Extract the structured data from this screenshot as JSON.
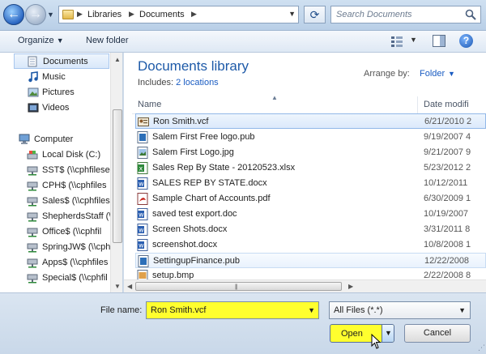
{
  "navigation": {
    "back_glyph": "←",
    "forward_glyph": "→",
    "address": {
      "crumbs": [
        "Libraries",
        "Documents"
      ]
    },
    "search": {
      "placeholder": "Search Documents"
    },
    "refresh_icon": "refresh-icon"
  },
  "toolbar": {
    "organize_label": "Organize",
    "new_folder_label": "New folder",
    "icons": [
      "views-icon",
      "preview-pane-icon",
      "help-icon"
    ]
  },
  "sidebar": {
    "items": [
      {
        "label": "Documents",
        "icon": "documents-icon",
        "selected": true
      },
      {
        "label": "Music",
        "icon": "music-icon"
      },
      {
        "label": "Pictures",
        "icon": "pictures-icon"
      },
      {
        "label": "Videos",
        "icon": "videos-icon"
      },
      {
        "label": "Computer",
        "icon": "computer-icon"
      },
      {
        "label": "Local Disk (C:)",
        "icon": "disk-icon"
      },
      {
        "label": "SST$ (\\\\cphfilese",
        "icon": "network-drive-icon"
      },
      {
        "label": "CPH$ (\\\\cphfiles",
        "icon": "network-drive-icon"
      },
      {
        "label": "Sales$ (\\\\cphfiles",
        "icon": "network-drive-icon"
      },
      {
        "label": "ShepherdsStaff (\\",
        "icon": "network-drive-icon"
      },
      {
        "label": "Office$ (\\\\cphfil",
        "icon": "network-drive-icon"
      },
      {
        "label": "SpringJW$ (\\\\cph",
        "icon": "network-drive-icon"
      },
      {
        "label": "Apps$ (\\\\cphfiles",
        "icon": "network-drive-icon"
      },
      {
        "label": "Special$ (\\\\cphfil",
        "icon": "network-drive-icon"
      }
    ]
  },
  "main": {
    "library_title": "Documents library",
    "includes_label": "Includes:",
    "includes_link": "2 locations",
    "arrange_label": "Arrange by:",
    "arrange_value": "Folder",
    "columns": {
      "name": "Name",
      "date": "Date modifi"
    },
    "files": [
      {
        "name": "Ron Smith.vcf",
        "date": "6/21/2010 2",
        "icon": "vcard-icon",
        "selected": true
      },
      {
        "name": "Salem First Free logo.pub",
        "date": "9/19/2007 4",
        "icon": "publisher-icon"
      },
      {
        "name": "Salem First Logo.jpg",
        "date": "9/21/2007 9",
        "icon": "image-icon"
      },
      {
        "name": "Sales Rep By State - 20120523.xlsx",
        "date": "5/23/2012 2",
        "icon": "excel-icon"
      },
      {
        "name": "SALES REP BY STATE.docx",
        "date": "10/12/2011",
        "icon": "word-icon"
      },
      {
        "name": "Sample Chart of Accounts.pdf",
        "date": "6/30/2009 1",
        "icon": "pdf-icon"
      },
      {
        "name": "saved test export.doc",
        "date": "10/19/2007",
        "icon": "word-icon"
      },
      {
        "name": "Screen Shots.docx",
        "date": "3/31/2011 8",
        "icon": "word-icon"
      },
      {
        "name": "screenshot.docx",
        "date": "10/8/2008 1",
        "icon": "word-icon"
      },
      {
        "name": "SettingupFinance.pub",
        "date": "12/22/2008",
        "icon": "publisher-icon",
        "hover": true
      },
      {
        "name": "setup.bmp",
        "date": "2/22/2008 8",
        "icon": "bitmap-icon"
      }
    ]
  },
  "footer": {
    "file_name_label": "File name:",
    "file_name_value": "Ron Smith.vcf",
    "file_type_value": "All Files (*.*)",
    "open_label": "Open",
    "cancel_label": "Cancel"
  },
  "colors": {
    "highlight": "#ffff2e",
    "link": "#1a5cc2",
    "title": "#1e5aa8",
    "selection_border": "#92b8e8"
  }
}
